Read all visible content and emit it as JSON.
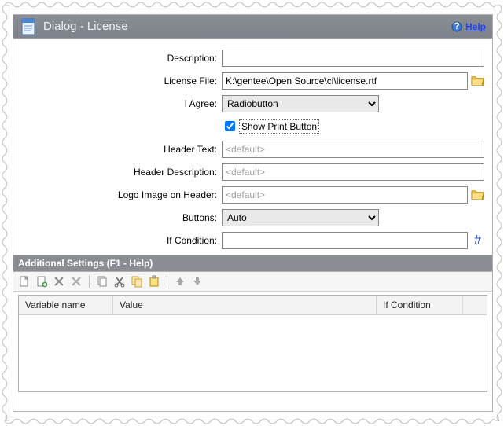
{
  "titlebar": {
    "title": "Dialog - License",
    "help_label": "Help"
  },
  "form": {
    "description": {
      "label": "Description:",
      "value": ""
    },
    "license_file": {
      "label": "License File:",
      "value": "K:\\gentee\\Open Source\\ci\\license.rtf"
    },
    "i_agree": {
      "label": "I Agree:",
      "selected": "Radiobutton"
    },
    "show_print": {
      "label": "Show Print Button",
      "checked": true
    },
    "header_text": {
      "label": "Header Text:",
      "value": "",
      "placeholder": "<default>"
    },
    "header_desc": {
      "label": "Header Description:",
      "value": "",
      "placeholder": "<default>"
    },
    "logo": {
      "label": "Logo Image on Header:",
      "value": "",
      "placeholder": "<default>"
    },
    "buttons": {
      "label": "Buttons:",
      "selected": "Auto"
    },
    "if_cond": {
      "label": "If Condition:",
      "value": ""
    }
  },
  "additional": {
    "header": "Additional Settings (F1 - Help)",
    "columns": {
      "c1": "Variable name",
      "c2": "Value",
      "c3": "If Condition",
      "c4": ""
    }
  }
}
